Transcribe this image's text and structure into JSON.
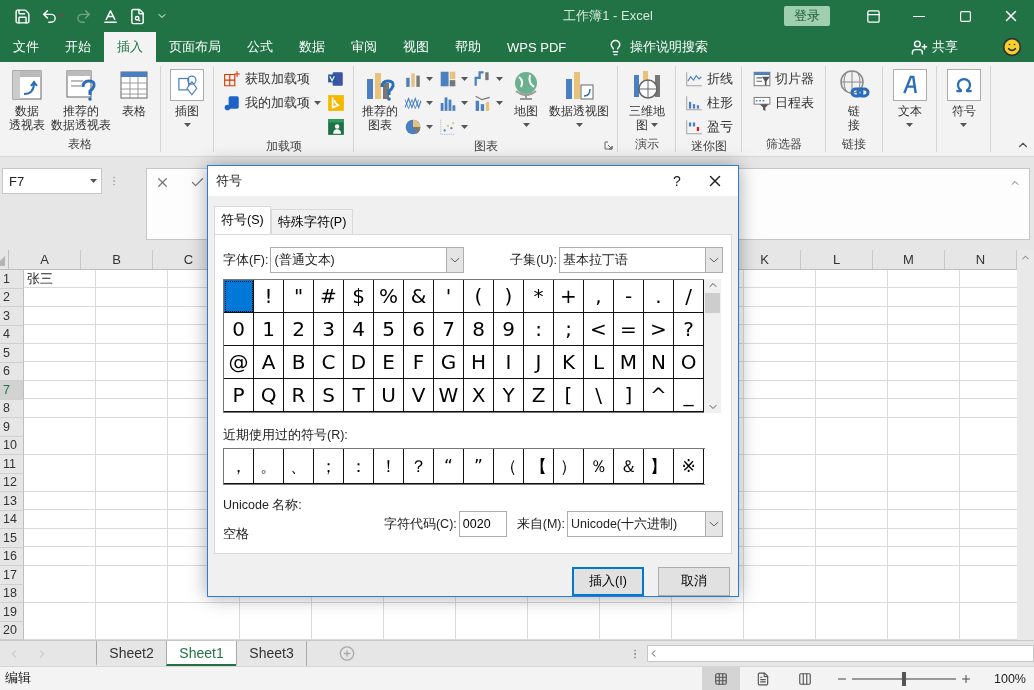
{
  "window": {
    "title": "工作簿1 - Excel",
    "sign_in": "登录"
  },
  "ribbon_tabs": [
    {
      "label": "文件",
      "selected": false
    },
    {
      "label": "开始",
      "selected": false
    },
    {
      "label": "插入",
      "selected": true
    },
    {
      "label": "页面布局",
      "selected": false
    },
    {
      "label": "公式",
      "selected": false
    },
    {
      "label": "数据",
      "selected": false
    },
    {
      "label": "审阅",
      "selected": false
    },
    {
      "label": "视图",
      "selected": false
    },
    {
      "label": "帮助",
      "selected": false
    },
    {
      "label": "WPS PDF",
      "selected": false
    }
  ],
  "tell_me": "操作说明搜索",
  "share": "共享",
  "ribbon_groups": [
    {
      "label": "表格",
      "launcher": false,
      "items": [
        {
          "kind": "large",
          "lines": [
            "数据",
            "透视表"
          ],
          "menu": false
        },
        {
          "kind": "large",
          "lines": [
            "推荐的",
            "数据透视表"
          ],
          "menu": false
        },
        {
          "kind": "large",
          "lines": [
            "表格"
          ],
          "menu": false
        }
      ]
    },
    {
      "launcher": false,
      "items": [
        {
          "kind": "boxed",
          "lines": [
            "插图"
          ],
          "menu": true
        }
      ]
    },
    {
      "label": "加载项",
      "launcher": false,
      "items": [
        {
          "kind": "stack",
          "items": [
            {
              "kind": "small",
              "text": "获取加载项",
              "menu": false
            },
            {
              "kind": "small",
              "text": "我的加载项",
              "menu": true
            }
          ]
        },
        {
          "kind": "stack",
          "items": [
            {
              "kind": "icon",
              "menu": false
            },
            {
              "kind": "icon",
              "menu": false
            },
            {
              "kind": "icon",
              "menu": false
            }
          ]
        }
      ]
    },
    {
      "label": "图表",
      "launcher": true,
      "items": [
        {
          "kind": "large",
          "lines": [
            "推荐的",
            "图表"
          ],
          "menu": false
        },
        {
          "kind": "stack",
          "items": [
            {
              "kind": "icon",
              "menu": true
            },
            {
              "kind": "icon",
              "menu": true
            },
            {
              "kind": "icon",
              "menu": true
            }
          ]
        },
        {
          "kind": "stack",
          "items": [
            {
              "kind": "icon",
              "menu": true
            },
            {
              "kind": "icon",
              "menu": true
            },
            {
              "kind": "icon",
              "menu": true
            }
          ]
        },
        {
          "kind": "stack",
          "items": [
            {
              "kind": "icon",
              "menu": true
            },
            {
              "kind": "icon",
              "menu": true
            }
          ]
        },
        {
          "kind": "large",
          "lines": [
            "地图"
          ],
          "menu": true
        },
        {
          "kind": "large",
          "lines": [
            "数据透视图"
          ],
          "menu": true
        }
      ]
    },
    {
      "label": "演示",
      "launcher": false,
      "items": [
        {
          "kind": "large",
          "lines": [
            "三维地",
            "图"
          ],
          "menu": true
        }
      ]
    },
    {
      "label": "迷你图",
      "launcher": false,
      "items": [
        {
          "kind": "stack",
          "items": [
            {
              "kind": "small",
              "text": "折线",
              "menu": false
            },
            {
              "kind": "small",
              "text": "柱形",
              "menu": false
            },
            {
              "kind": "small",
              "text": "盈亏",
              "menu": false
            }
          ]
        }
      ]
    },
    {
      "label": "筛选器",
      "launcher": false,
      "items": [
        {
          "kind": "stack",
          "items": [
            {
              "kind": "small",
              "text": "切片器",
              "menu": false
            },
            {
              "kind": "small",
              "text": "日程表",
              "menu": false
            }
          ]
        }
      ]
    },
    {
      "label": "链接",
      "launcher": false,
      "items": [
        {
          "kind": "large",
          "lines": [
            "链",
            "接"
          ],
          "menu": false
        }
      ]
    },
    {
      "launcher": false,
      "items": [
        {
          "kind": "boxed",
          "lines": [
            "文本"
          ],
          "menu": true
        }
      ]
    },
    {
      "launcher": false,
      "items": [
        {
          "kind": "boxed",
          "lines": [
            "符号"
          ],
          "menu": true
        }
      ]
    }
  ],
  "name_box": "F7",
  "columns": [
    "A",
    "B",
    "C",
    "K",
    "L",
    "M",
    "N"
  ],
  "rows": [
    {
      "number": "1",
      "selected": false,
      "cells": [
        "张三"
      ]
    },
    {
      "number": "2",
      "selected": false
    },
    {
      "number": "3",
      "selected": false
    },
    {
      "number": "4",
      "selected": false
    },
    {
      "number": "5",
      "selected": false
    },
    {
      "number": "6",
      "selected": false
    },
    {
      "number": "7",
      "selected": true
    },
    {
      "number": "8",
      "selected": false
    },
    {
      "number": "9",
      "selected": false
    },
    {
      "number": "10",
      "selected": false
    },
    {
      "number": "11",
      "selected": false
    },
    {
      "number": "12",
      "selected": false
    },
    {
      "number": "13",
      "selected": false
    },
    {
      "number": "14",
      "selected": false
    },
    {
      "number": "15",
      "selected": false
    },
    {
      "number": "16",
      "selected": false
    },
    {
      "number": "17",
      "selected": false
    },
    {
      "number": "18",
      "selected": false
    },
    {
      "number": "19",
      "selected": false
    },
    {
      "number": "20",
      "selected": false
    }
  ],
  "sheets": [
    {
      "label": "Sheet2",
      "selected": false
    },
    {
      "label": "Sheet1",
      "selected": true
    },
    {
      "label": "Sheet3",
      "selected": false
    }
  ],
  "status": {
    "mode": "编辑",
    "views": [
      {
        "selected": true
      },
      {
        "selected": false
      },
      {
        "selected": false
      }
    ],
    "zoom": {
      "level": 0.5,
      "reading": "100%"
    }
  },
  "dialog": {
    "title": "符号",
    "help": "?",
    "tabs": [
      {
        "label": "符号(S)",
        "selected": true
      },
      {
        "label": "特殊字符(P)",
        "selected": false
      }
    ],
    "font": {
      "label": "字体(F):",
      "value": "(普通文本)"
    },
    "subset": {
      "label": "子集(U):",
      "value": "基本拉丁语"
    },
    "symbols": [
      {
        "selected": true
      },
      {
        "char": "!",
        "selected": false
      },
      {
        "char": "\"",
        "selected": false
      },
      {
        "char": "#",
        "selected": false
      },
      {
        "char": "$",
        "selected": false
      },
      {
        "char": "%",
        "selected": false
      },
      {
        "char": "&",
        "selected": false
      },
      {
        "char": "'",
        "selected": false
      },
      {
        "char": "(",
        "selected": false
      },
      {
        "char": ")",
        "selected": false
      },
      {
        "char": "*",
        "selected": false
      },
      {
        "char": "+",
        "selected": false
      },
      {
        "char": ",",
        "selected": false
      },
      {
        "char": "-",
        "selected": false
      },
      {
        "char": ".",
        "selected": false
      },
      {
        "char": "/",
        "selected": false
      },
      {
        "char": "0",
        "selected": false
      },
      {
        "char": "1",
        "selected": false
      },
      {
        "char": "2",
        "selected": false
      },
      {
        "char": "3",
        "selected": false
      },
      {
        "char": "4",
        "selected": false
      },
      {
        "char": "5",
        "selected": false
      },
      {
        "char": "6",
        "selected": false
      },
      {
        "char": "7",
        "selected": false
      },
      {
        "char": "8",
        "selected": false
      },
      {
        "char": "9",
        "selected": false
      },
      {
        "char": ":",
        "selected": false
      },
      {
        "char": ";",
        "selected": false
      },
      {
        "char": "<",
        "selected": false
      },
      {
        "char": "=",
        "selected": false
      },
      {
        "char": ">",
        "selected": false
      },
      {
        "char": "?",
        "selected": false
      },
      {
        "char": "@",
        "selected": false
      },
      {
        "char": "A",
        "selected": false
      },
      {
        "char": "B",
        "selected": false
      },
      {
        "char": "C",
        "selected": false
      },
      {
        "char": "D",
        "selected": false
      },
      {
        "char": "E",
        "selected": false
      },
      {
        "char": "F",
        "selected": false
      },
      {
        "char": "G",
        "selected": false
      },
      {
        "char": "H",
        "selected": false
      },
      {
        "char": "I",
        "selected": false
      },
      {
        "char": "J",
        "selected": false
      },
      {
        "char": "K",
        "selected": false
      },
      {
        "char": "L",
        "selected": false
      },
      {
        "char": "M",
        "selected": false
      },
      {
        "char": "N",
        "selected": false
      },
      {
        "char": "O",
        "selected": false
      },
      {
        "char": "P",
        "selected": false
      },
      {
        "char": "Q",
        "selected": false
      },
      {
        "char": "R",
        "selected": false
      },
      {
        "char": "S",
        "selected": false
      },
      {
        "char": "T",
        "selected": false
      },
      {
        "char": "U",
        "selected": false
      },
      {
        "char": "V",
        "selected": false
      },
      {
        "char": "W",
        "selected": false
      },
      {
        "char": "X",
        "selected": false
      },
      {
        "char": "Y",
        "selected": false
      },
      {
        "char": "Z",
        "selected": false
      },
      {
        "char": "[",
        "selected": false
      },
      {
        "char": "\\",
        "selected": false
      },
      {
        "char": "]",
        "selected": false
      },
      {
        "char": "^",
        "selected": false
      },
      {
        "char": "_",
        "selected": false
      }
    ],
    "recent_label": "近期使用过的符号(R):",
    "recent": [
      "，",
      "。",
      "、",
      "；",
      "：",
      "！",
      "？",
      "“",
      "”",
      "（",
      "【",
      "）",
      "％",
      "＆",
      "】",
      "※"
    ],
    "unicode_name_label": "Unicode 名称:",
    "unicode_name": "空格",
    "char_code": {
      "label": "字符代码(C):",
      "value": "0020"
    },
    "from": {
      "label": "来自(M):",
      "value": "Unicode(十六进制)"
    },
    "buttons": [
      {
        "label": "插入(I)",
        "default": true
      },
      {
        "label": "取消",
        "default": false
      }
    ]
  }
}
